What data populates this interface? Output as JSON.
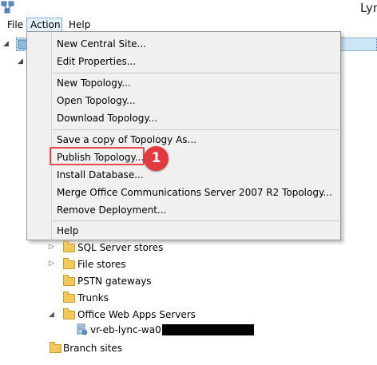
{
  "window": {
    "title": "Lync"
  },
  "menubar": {
    "items": [
      "File",
      "Action",
      "Help"
    ]
  },
  "action_menu": {
    "groups": [
      [
        "New Central Site...",
        "Edit Properties..."
      ],
      [
        "New Topology...",
        "Open Topology...",
        "Download Topology..."
      ],
      [
        "Save a copy of Topology As...",
        "Publish Topology...",
        "Install Database...",
        "Merge Office Communications Server 2007 R2 Topology...",
        "Remove Deployment..."
      ],
      [
        "Help"
      ]
    ],
    "highlighted_item": "Publish Topology...",
    "callout_number": "1",
    "callout_color": "#e23a3f"
  },
  "tree": {
    "nodes": [
      {
        "label": "SQL Server stores",
        "expanded": false
      },
      {
        "label": "File stores",
        "expanded": false
      },
      {
        "label": "PSTN gateways"
      },
      {
        "label": "Trunks"
      },
      {
        "label": "Office Web Apps Servers",
        "expanded": true
      },
      {
        "label": "vr-eb-lync-wa01."
      },
      {
        "label": "Branch sites"
      }
    ]
  },
  "colors": {
    "menu_background": "#f0f0f0",
    "selection_blue": "#cde6f7",
    "highlight_red": "#e8484f",
    "folder_yellow": "#f4c95b"
  }
}
